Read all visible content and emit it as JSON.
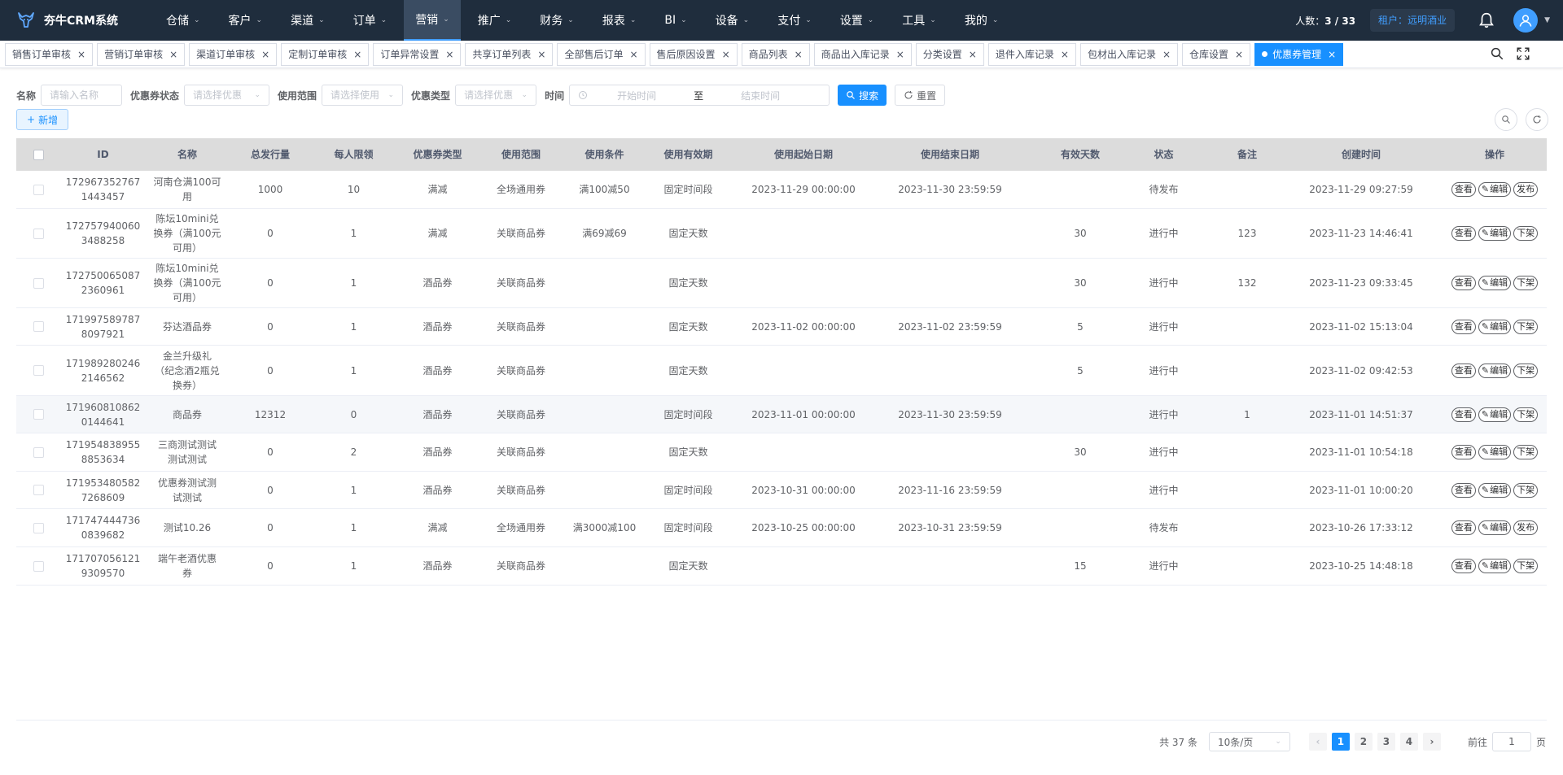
{
  "app": {
    "title": "夯牛CRM系统"
  },
  "nav": {
    "items": [
      {
        "label": "仓储"
      },
      {
        "label": "客户"
      },
      {
        "label": "渠道"
      },
      {
        "label": "订单"
      },
      {
        "label": "营销"
      },
      {
        "label": "推广"
      },
      {
        "label": "财务"
      },
      {
        "label": "报表"
      },
      {
        "label": "BI"
      },
      {
        "label": "设备"
      },
      {
        "label": "支付"
      },
      {
        "label": "设置"
      },
      {
        "label": "工具"
      },
      {
        "label": "我的"
      }
    ],
    "active_index": 4
  },
  "header_right": {
    "people_label": "人数：",
    "people_value": "3 / 33",
    "tenant_label": "租户：",
    "tenant_value": "远明酒业",
    "bell_icon": "bell-icon",
    "avatar_icon": "user-icon"
  },
  "tabs": [
    {
      "label": "销售订单审核"
    },
    {
      "label": "营销订单审核"
    },
    {
      "label": "渠道订单审核"
    },
    {
      "label": "定制订单审核"
    },
    {
      "label": "订单异常设置"
    },
    {
      "label": "共享订单列表"
    },
    {
      "label": "全部售后订单"
    },
    {
      "label": "售后原因设置"
    },
    {
      "label": "商品列表"
    },
    {
      "label": "商品出入库记录"
    },
    {
      "label": "分类设置"
    },
    {
      "label": "退件入库记录"
    },
    {
      "label": "包材出入库记录"
    },
    {
      "label": "仓库设置"
    },
    {
      "label": "优惠券管理"
    }
  ],
  "filters": {
    "name_label": "名称",
    "name_placeholder": "请输入名称",
    "status_label": "优惠券状态",
    "status_placeholder": "请选择优惠",
    "scope_label": "使用范围",
    "scope_placeholder": "请选择使用",
    "type_label": "优惠类型",
    "type_placeholder": "请选择优惠",
    "time_label": "时间",
    "start_placeholder": "开始时间",
    "range_sep": "至",
    "end_placeholder": "结束时间",
    "search_label": "搜索",
    "reset_label": "重置"
  },
  "toolbar": {
    "add_label": "新增"
  },
  "table": {
    "columns": [
      "ID",
      "名称",
      "总发行量",
      "每人限领",
      "优惠券类型",
      "使用范围",
      "使用条件",
      "使用有效期",
      "使用起始日期",
      "使用结束日期",
      "有效天数",
      "状态",
      "备注",
      "创建时间",
      "操作"
    ],
    "rows": [
      {
        "id": [
          "172967352767",
          "1443457"
        ],
        "name": [
          "河南仓满100可",
          "用"
        ],
        "total": "1000",
        "limit": "10",
        "type": "满减",
        "scope": "全场通用券",
        "cond": "满100减50",
        "valid": "固定时间段",
        "start": "2023-11-29 00:00:00",
        "end": "2023-11-30 23:59:59",
        "days": "",
        "status": "待发布",
        "remark": "",
        "created": "2023-11-29 09:27:59",
        "ops": [
          "查看",
          "编辑",
          "发布"
        ]
      },
      {
        "id": [
          "172757940060",
          "3488258"
        ],
        "name": [
          "陈坛10mini兑",
          "换券（满100元",
          "可用）"
        ],
        "total": "0",
        "limit": "1",
        "type": "满减",
        "scope": "关联商品券",
        "cond": "满69减69",
        "valid": "固定天数",
        "start": "",
        "end": "",
        "days": "30",
        "status": "进行中",
        "remark": "123",
        "created": "2023-11-23 14:46:41",
        "ops": [
          "查看",
          "编辑",
          "下架"
        ]
      },
      {
        "id": [
          "172750065087",
          "2360961"
        ],
        "name": [
          "陈坛10mini兑",
          "换券（满100元",
          "可用）"
        ],
        "total": "0",
        "limit": "1",
        "type": "酒品券",
        "scope": "关联商品券",
        "cond": "",
        "valid": "固定天数",
        "start": "",
        "end": "",
        "days": "30",
        "status": "进行中",
        "remark": "132",
        "created": "2023-11-23 09:33:45",
        "ops": [
          "查看",
          "编辑",
          "下架"
        ]
      },
      {
        "id": [
          "171997589787",
          "8097921"
        ],
        "name": [
          "芬达酒品券"
        ],
        "total": "0",
        "limit": "1",
        "type": "酒品券",
        "scope": "关联商品券",
        "cond": "",
        "valid": "固定天数",
        "start": "2023-11-02 00:00:00",
        "end": "2023-11-02 23:59:59",
        "days": "5",
        "status": "进行中",
        "remark": "",
        "created": "2023-11-02 15:13:04",
        "ops": [
          "查看",
          "编辑",
          "下架"
        ]
      },
      {
        "id": [
          "171989280246",
          "2146562"
        ],
        "name": [
          "金兰升级礼",
          "（纪念酒2瓶兑",
          "换券）"
        ],
        "total": "0",
        "limit": "1",
        "type": "酒品券",
        "scope": "关联商品券",
        "cond": "",
        "valid": "固定天数",
        "start": "",
        "end": "",
        "days": "5",
        "status": "进行中",
        "remark": "",
        "created": "2023-11-02 09:42:53",
        "ops": [
          "查看",
          "编辑",
          "下架"
        ]
      },
      {
        "id": [
          "171960810862",
          "0144641"
        ],
        "name": [
          "商品券"
        ],
        "total": "12312",
        "limit": "0",
        "type": "酒品券",
        "scope": "关联商品券",
        "cond": "",
        "valid": "固定时间段",
        "start": "2023-11-01 00:00:00",
        "end": "2023-11-30 23:59:59",
        "days": "",
        "status": "进行中",
        "remark": "1",
        "created": "2023-11-01 14:51:37",
        "ops": [
          "查看",
          "编辑",
          "下架"
        ]
      },
      {
        "id": [
          "171954838955",
          "8853634"
        ],
        "name": [
          "三商测试测试",
          "测试测试"
        ],
        "total": "0",
        "limit": "2",
        "type": "酒品券",
        "scope": "关联商品券",
        "cond": "",
        "valid": "固定天数",
        "start": "",
        "end": "",
        "days": "30",
        "status": "进行中",
        "remark": "",
        "created": "2023-11-01 10:54:18",
        "ops": [
          "查看",
          "编辑",
          "下架"
        ]
      },
      {
        "id": [
          "171953480582",
          "7268609"
        ],
        "name": [
          "优惠券测试测",
          "试测试"
        ],
        "total": "0",
        "limit": "1",
        "type": "酒品券",
        "scope": "关联商品券",
        "cond": "",
        "valid": "固定时间段",
        "start": "2023-10-31 00:00:00",
        "end": "2023-11-16 23:59:59",
        "days": "",
        "status": "进行中",
        "remark": "",
        "created": "2023-11-01 10:00:20",
        "ops": [
          "查看",
          "编辑",
          "下架"
        ]
      },
      {
        "id": [
          "171747444736",
          "0839682"
        ],
        "name": [
          "测试10.26"
        ],
        "total": "0",
        "limit": "1",
        "type": "满减",
        "scope": "全场通用券",
        "cond": "满3000减100",
        "valid": "固定时间段",
        "start": "2023-10-25 00:00:00",
        "end": "2023-10-31 23:59:59",
        "days": "",
        "status": "待发布",
        "remark": "",
        "created": "2023-10-26 17:33:12",
        "ops": [
          "查看",
          "编辑",
          "发布"
        ]
      },
      {
        "id": [
          "171707056121",
          "9309570"
        ],
        "name": [
          "端午老酒优惠",
          "券"
        ],
        "total": "0",
        "limit": "1",
        "type": "酒品券",
        "scope": "关联商品券",
        "cond": "",
        "valid": "固定天数",
        "start": "",
        "end": "",
        "days": "15",
        "status": "进行中",
        "remark": "",
        "created": "2023-10-25 14:48:18",
        "ops": [
          "查看",
          "编辑",
          "下架"
        ]
      }
    ]
  },
  "pagination": {
    "total_text": "共 37 条",
    "page_size": "10条/页",
    "pages": [
      "1",
      "2",
      "3",
      "4"
    ],
    "current": "1",
    "goto_label": "前往",
    "goto_value": "1",
    "goto_suffix": "页"
  },
  "colors": {
    "nav_bg": "#1f2d3d",
    "accent": "#1890ff",
    "table_header": "#dcdcdc"
  }
}
